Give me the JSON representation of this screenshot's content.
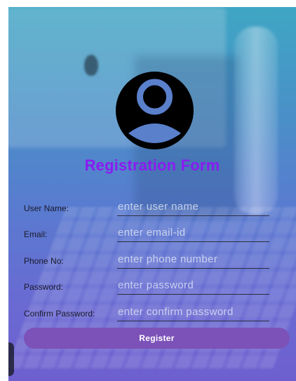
{
  "colors": {
    "title": "#8a1cf0",
    "button_bg": "#7c52b8",
    "button_text": "#ffffff",
    "label_text": "#1a1a2a",
    "placeholder_text": "#e6ecf5",
    "avatar": "#000000"
  },
  "header": {
    "avatar_icon": "user-circle-icon",
    "title": "Registration Form"
  },
  "form": {
    "fields": [
      {
        "label": "User Name:",
        "placeholder": "enter user name",
        "value": ""
      },
      {
        "label": "Email:",
        "placeholder": "enter email-id",
        "value": ""
      },
      {
        "label": "Phone No:",
        "placeholder": "enter phone number",
        "value": ""
      },
      {
        "label": "Password:",
        "placeholder": "enter password",
        "value": ""
      },
      {
        "label": "Confirm Password:",
        "placeholder": "enter confirm password",
        "value": ""
      }
    ],
    "submit_label": "Register"
  }
}
